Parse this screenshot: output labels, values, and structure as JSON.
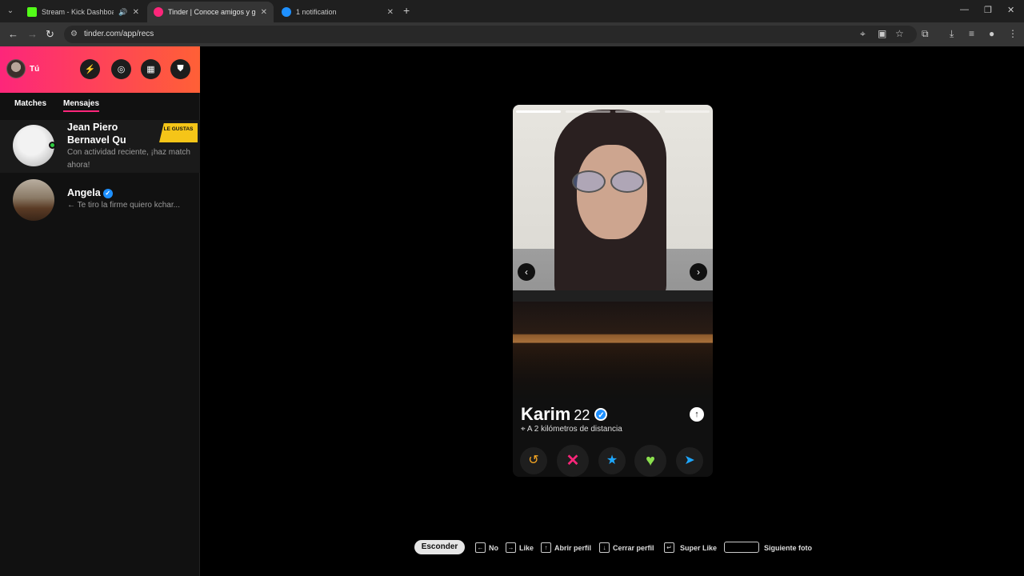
{
  "browser": {
    "tabs": [
      {
        "title": "Stream - Kick Dashboard",
        "favicon_color": "#53fc18"
      },
      {
        "title": "Tinder | Conoce amigos y gent",
        "favicon_color": "#fd267a"
      },
      {
        "title": "1 notification",
        "favicon_color": "#1e90ff"
      }
    ],
    "url": "tinder.com/app/recs"
  },
  "sidebar": {
    "me_label": "Tú",
    "tabs": [
      "Matches",
      "Mensajes"
    ],
    "active_tab": "Mensajes",
    "messages": [
      {
        "name": "Jean Piero Bernavel Qu",
        "preview": "Con actividad reciente, ¡haz match ahora!",
        "badge": "LE GUSTAS",
        "online": true
      },
      {
        "name": "Angela",
        "preview": "← Te tiro la firme quiero kchar...",
        "verified": true
      }
    ]
  },
  "card": {
    "name": "Karim",
    "age": "22",
    "distance": "A 2 kilómetros de distancia",
    "photo_count": 4,
    "current_photo": 1
  },
  "footer": {
    "hide_label": "Esconder",
    "shortcuts": [
      {
        "key": "←",
        "label": "No"
      },
      {
        "key": "→",
        "label": "Like"
      },
      {
        "key": "↑",
        "label": "Abrir perfil"
      },
      {
        "key": "↓",
        "label": "Cerrar perfil"
      },
      {
        "key": "↵",
        "label": "Super Like"
      },
      {
        "key": "",
        "label": "Siguiente foto"
      }
    ]
  },
  "colors": {
    "brand_start": "#fd267a",
    "brand_end": "#ff6036",
    "badge": "#f5c518",
    "verified": "#1e90ff"
  }
}
